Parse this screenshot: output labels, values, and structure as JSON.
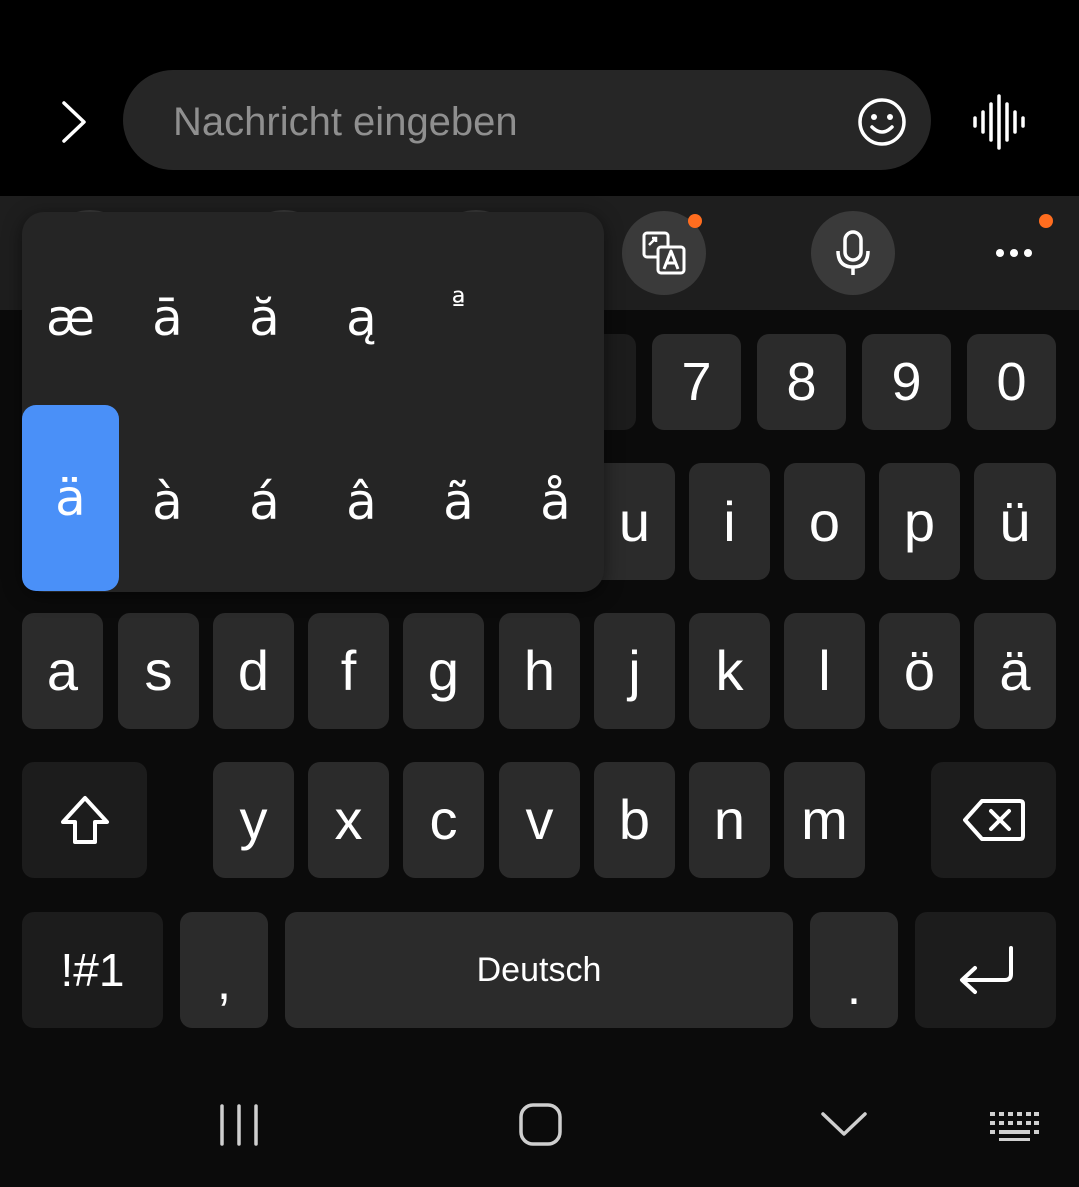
{
  "input_bar": {
    "placeholder": "Nachricht eingeben",
    "expand_icon": "chevron-right-icon",
    "emoji_icon": "smiley-icon",
    "voice_icon": "waveform-icon"
  },
  "toolbar": {
    "items": [
      {
        "icon": "translate-icon",
        "badge": true
      },
      {
        "icon": "microphone-icon",
        "badge": false
      },
      {
        "icon": "more-dots-icon",
        "badge": true
      }
    ]
  },
  "accent_popup": {
    "row1": [
      "æ",
      "ā",
      "ă",
      "ą",
      "ª"
    ],
    "row2": [
      "ä",
      "à",
      "á",
      "â",
      "ã",
      "å"
    ],
    "selected": "ä"
  },
  "keyboard": {
    "number_row": [
      "7",
      "8",
      "9",
      "0"
    ],
    "row1": [
      "u",
      "i",
      "o",
      "p",
      "ü"
    ],
    "row2": [
      "a",
      "s",
      "d",
      "f",
      "g",
      "h",
      "j",
      "k",
      "l",
      "ö",
      "ä"
    ],
    "row3": [
      "y",
      "x",
      "c",
      "v",
      "b",
      "n",
      "m"
    ],
    "symbols_label": "!#1",
    "comma_label": ",",
    "space_label": "Deutsch",
    "period_label": ".",
    "shift_icon": "shift-icon",
    "backspace_icon": "backspace-icon",
    "enter_icon": "enter-icon"
  },
  "nav_bar": {
    "recents_icon": "recents-icon",
    "home_icon": "home-icon",
    "hide_keyboard_icon": "chevron-down-icon",
    "keyboard_switch_icon": "keyboard-icon"
  },
  "colors": {
    "accent_selected": "#4a90f8",
    "badge": "#ff6d1f",
    "key_bg": "#2b2b2b"
  }
}
